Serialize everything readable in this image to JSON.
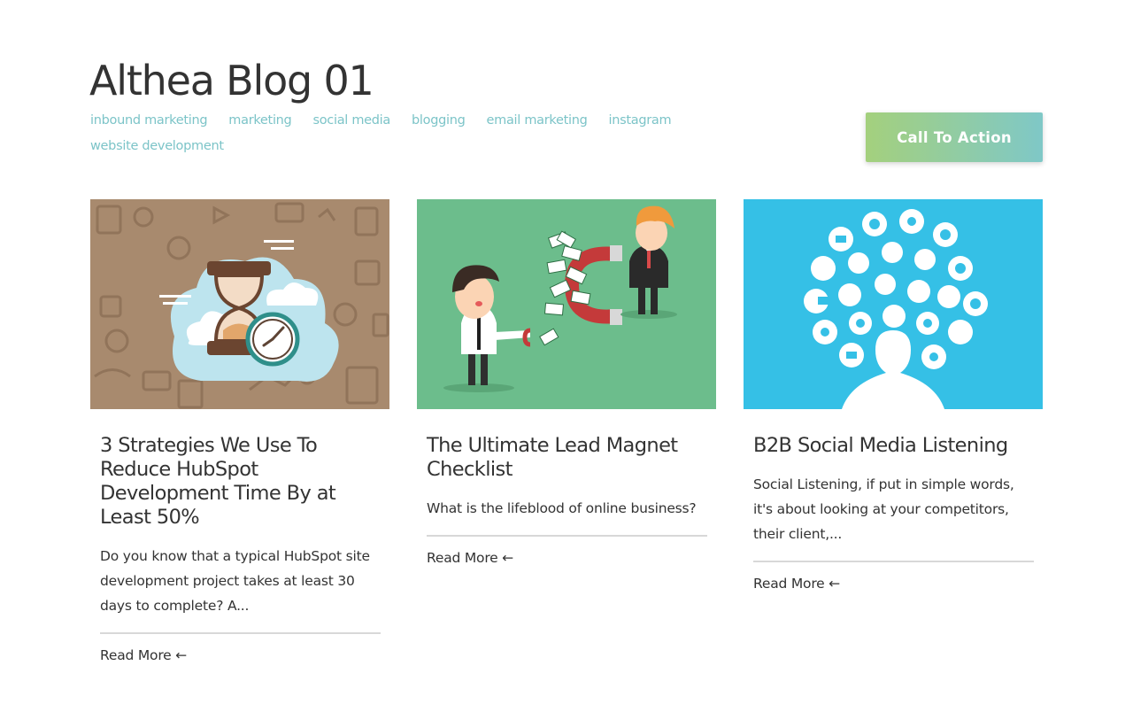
{
  "blog": {
    "title": "Althea Blog 01"
  },
  "tags": [
    "inbound marketing",
    "marketing",
    "social media",
    "blogging",
    "email marketing",
    "instagram",
    "website development"
  ],
  "cta": {
    "label": "Call To Action"
  },
  "posts": [
    {
      "title": "3 Strategies We Use To Reduce HubSpot Development Time By at Least 50%",
      "excerpt": "Do you know that a typical HubSpot site development project takes at least 30 days to complete? A...",
      "read_more": "Read More ←"
    },
    {
      "title": "The Ultimate Lead Magnet Checklist",
      "excerpt": "What is the lifeblood of online business?",
      "read_more": "Read More ←"
    },
    {
      "title": "B2B Social Media Listening",
      "excerpt": "Social Listening, if put in simple words, it's about looking at your competitors, their client,...",
      "read_more": "Read More ←"
    }
  ],
  "colors": {
    "tag": "#7cc4c8",
    "cta_start": "#a4d07d",
    "cta_end": "#7fc8c7",
    "thumb_1_bg": "#a88a6e",
    "thumb_2_bg": "#6cbd8c",
    "thumb_3_bg": "#35c0e6"
  },
  "icons": [
    "hourglass-clock-illustration",
    "magnet-money-illustration",
    "social-media-head-illustration",
    "arrow-left-icon"
  ]
}
